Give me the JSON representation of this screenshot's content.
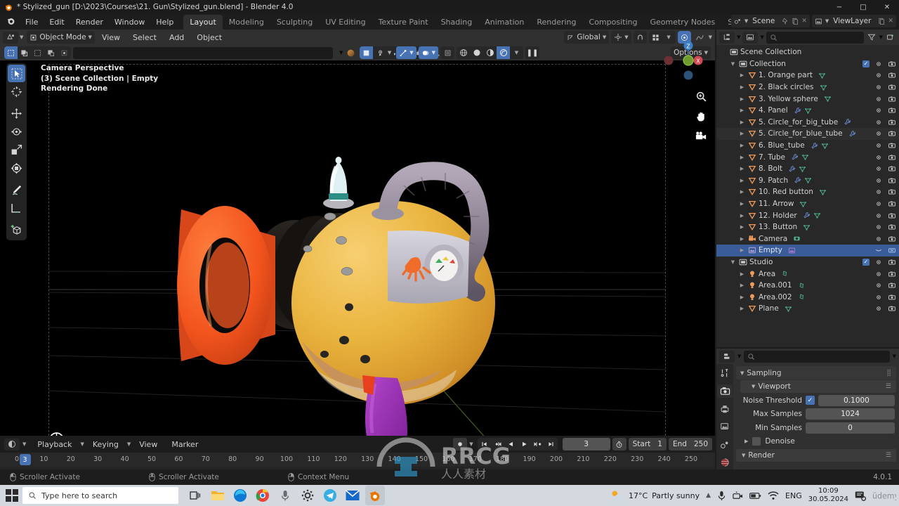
{
  "window": {
    "title": "* Stylized_gun [D:\\2023\\Courses\\21. Gun\\Stylized_gun.blend] - Blender 4.0",
    "minimize": "−",
    "maximize": "□",
    "close": "✕"
  },
  "topbar": {
    "menus": [
      "File",
      "Edit",
      "Render",
      "Window",
      "Help"
    ],
    "workspaces": [
      {
        "label": "Layout",
        "active": true
      },
      {
        "label": "Modeling",
        "active": false
      },
      {
        "label": "Sculpting",
        "active": false
      },
      {
        "label": "UV Editing",
        "active": false
      },
      {
        "label": "Texture Paint",
        "active": false
      },
      {
        "label": "Shading",
        "active": false
      },
      {
        "label": "Animation",
        "active": false
      },
      {
        "label": "Rendering",
        "active": false
      },
      {
        "label": "Compositing",
        "active": false
      },
      {
        "label": "Geometry Nodes",
        "active": false
      },
      {
        "label": "Scripting",
        "active": false
      },
      {
        "label": "+",
        "active": false
      }
    ],
    "scene_name": "Scene",
    "viewlayer_name": "ViewLayer"
  },
  "viewport": {
    "mode": "Object Mode",
    "menus": [
      "View",
      "Select",
      "Add",
      "Object"
    ],
    "transform_orientation": "Global",
    "options_label": "Options",
    "overlay_lines": [
      "Camera Perspective",
      "(3) Scene Collection | Empty",
      "Rendering Done"
    ],
    "gizmo_axes": {
      "x": "X",
      "y": "Y",
      "z": "Z"
    },
    "tools": [
      "tweak-select-tool",
      "cursor-tool",
      "move-tool",
      "rotate-tool",
      "scale-tool",
      "transform-tool",
      "annotate-tool",
      "measure-tool",
      "add-cube-tool"
    ]
  },
  "timeline": {
    "editor_menus": [
      "Playback",
      "Keying",
      "View",
      "Marker"
    ],
    "current_frame": "3",
    "start_label": "Start",
    "start_value": "1",
    "end_label": "End",
    "end_value": "250",
    "ticks": [
      "0",
      "10",
      "20",
      "30",
      "40",
      "50",
      "60",
      "70",
      "80",
      "90",
      "100",
      "110",
      "120",
      "130",
      "140",
      "150",
      "160",
      "170",
      "180",
      "190",
      "200",
      "210",
      "220",
      "230",
      "240",
      "250"
    ]
  },
  "outliner": {
    "search_placeholder": "",
    "rows": [
      {
        "indent": 0,
        "label": "Scene Collection",
        "icon": "collection-icon",
        "arrow": "",
        "mods": [],
        "checkbox": false,
        "eye": false,
        "camera": false,
        "selected": false
      },
      {
        "indent": 1,
        "label": "Collection",
        "icon": "collection-icon",
        "arrow": "▼",
        "mods": [],
        "checkbox": true,
        "eye": true,
        "camera": true,
        "selected": false
      },
      {
        "indent": 2,
        "label": "1. Orange part",
        "icon": "mesh-icon",
        "arrow": "▶",
        "mods": [
          "mesh-data"
        ],
        "checkbox": false,
        "eye": true,
        "camera": true,
        "selected": false
      },
      {
        "indent": 2,
        "label": "2. Black circles",
        "icon": "mesh-icon",
        "arrow": "▶",
        "mods": [
          "mesh-data"
        ],
        "checkbox": false,
        "eye": true,
        "camera": true,
        "selected": false
      },
      {
        "indent": 2,
        "label": "3. Yellow sphere",
        "icon": "mesh-icon",
        "arrow": "▶",
        "mods": [
          "mesh-data"
        ],
        "checkbox": false,
        "eye": true,
        "camera": true,
        "selected": false
      },
      {
        "indent": 2,
        "label": "4. Panel",
        "icon": "mesh-icon",
        "arrow": "▶",
        "mods": [
          "modifier",
          "mesh-data"
        ],
        "checkbox": false,
        "eye": true,
        "camera": true,
        "selected": false
      },
      {
        "indent": 2,
        "label": "5. Circle_for_big_tube",
        "icon": "mesh-icon",
        "arrow": "▶",
        "mods": [
          "modifier"
        ],
        "checkbox": false,
        "eye": true,
        "camera": true,
        "selected": false
      },
      {
        "indent": 2,
        "label": "5. Circle_for_blue_tube",
        "icon": "mesh-icon",
        "arrow": "▶",
        "mods": [
          "modifier"
        ],
        "checkbox": false,
        "eye": true,
        "camera": true,
        "selected": false
      },
      {
        "indent": 2,
        "label": "6. Blue_tube",
        "icon": "mesh-icon",
        "arrow": "▶",
        "mods": [
          "modifier",
          "mesh-data"
        ],
        "checkbox": false,
        "eye": true,
        "camera": true,
        "selected": false
      },
      {
        "indent": 2,
        "label": "7. Tube",
        "icon": "mesh-icon",
        "arrow": "▶",
        "mods": [
          "modifier",
          "mesh-data"
        ],
        "checkbox": false,
        "eye": true,
        "camera": true,
        "selected": false
      },
      {
        "indent": 2,
        "label": "8. Bolt",
        "icon": "mesh-icon",
        "arrow": "▶",
        "mods": [
          "modifier",
          "mesh-data"
        ],
        "checkbox": false,
        "eye": true,
        "camera": true,
        "selected": false
      },
      {
        "indent": 2,
        "label": "9. Patch",
        "icon": "mesh-icon",
        "arrow": "▶",
        "mods": [
          "modifier",
          "mesh-data"
        ],
        "checkbox": false,
        "eye": true,
        "camera": true,
        "selected": false
      },
      {
        "indent": 2,
        "label": "10. Red button",
        "icon": "mesh-icon",
        "arrow": "▶",
        "mods": [
          "mesh-data"
        ],
        "checkbox": false,
        "eye": true,
        "camera": true,
        "selected": false
      },
      {
        "indent": 2,
        "label": "11. Arrow",
        "icon": "mesh-icon",
        "arrow": "▶",
        "mods": [
          "mesh-data"
        ],
        "checkbox": false,
        "eye": true,
        "camera": true,
        "selected": false
      },
      {
        "indent": 2,
        "label": "12. Holder",
        "icon": "mesh-icon",
        "arrow": "▶",
        "mods": [
          "modifier",
          "mesh-data"
        ],
        "checkbox": false,
        "eye": true,
        "camera": true,
        "selected": false
      },
      {
        "indent": 2,
        "label": "13. Button",
        "icon": "mesh-icon",
        "arrow": "▶",
        "mods": [
          "mesh-data"
        ],
        "checkbox": false,
        "eye": true,
        "camera": true,
        "selected": false
      },
      {
        "indent": 2,
        "label": "Camera",
        "icon": "camera-object-icon",
        "arrow": "▶",
        "mods": [
          "camera-data"
        ],
        "checkbox": false,
        "eye": true,
        "camera": true,
        "selected": false
      },
      {
        "indent": 2,
        "label": "Empty",
        "icon": "empty-image-icon",
        "arrow": "▶",
        "mods": [
          "empty-data"
        ],
        "checkbox": false,
        "eye": true,
        "camera": true,
        "selected": true
      },
      {
        "indent": 1,
        "label": "Studio",
        "icon": "collection-icon",
        "arrow": "▼",
        "mods": [],
        "checkbox": true,
        "eye": true,
        "camera": true,
        "selected": false
      },
      {
        "indent": 2,
        "label": "Area",
        "icon": "light-icon",
        "arrow": "▶",
        "mods": [
          "light-data"
        ],
        "checkbox": false,
        "eye": true,
        "camera": true,
        "selected": false
      },
      {
        "indent": 2,
        "label": "Area.001",
        "icon": "light-icon",
        "arrow": "▶",
        "mods": [
          "light-data"
        ],
        "checkbox": false,
        "eye": true,
        "camera": true,
        "selected": false
      },
      {
        "indent": 2,
        "label": "Area.002",
        "icon": "light-icon",
        "arrow": "▶",
        "mods": [
          "light-data"
        ],
        "checkbox": false,
        "eye": true,
        "camera": true,
        "selected": false
      },
      {
        "indent": 2,
        "label": "Plane",
        "icon": "mesh-icon",
        "arrow": "▶",
        "mods": [
          "mesh-data"
        ],
        "checkbox": false,
        "eye": true,
        "camera": true,
        "selected": false
      }
    ]
  },
  "properties": {
    "search_placeholder": "",
    "tabs": [
      "tool-tab",
      "render-tab",
      "output-tab",
      "viewlayer-tab",
      "scene-tab",
      "world-tab"
    ],
    "active_tab": "render-tab",
    "sampling_label": "Sampling",
    "viewport_label": "Viewport",
    "noise_threshold_label": "Noise Threshold",
    "noise_threshold_value": "0.1000",
    "noise_threshold_enabled": true,
    "max_samples_label": "Max Samples",
    "max_samples_value": "1024",
    "min_samples_label": "Min Samples",
    "min_samples_value": "0",
    "denoise_label": "Denoise",
    "render_label": "Render"
  },
  "statusbar": {
    "items": [
      "Scroller Activate",
      "Scroller Activate",
      "Context Menu"
    ],
    "version": "4.0.1"
  },
  "taskbar": {
    "search_placeholder": "Type here to search",
    "weather_temp": "17°C",
    "weather_desc": "Partly sunny",
    "language": "ENG",
    "time": "10:09",
    "date": "30.05.2024"
  },
  "colors": {
    "accent_blue": "#4772b3",
    "orange": "#f15a24",
    "yellow": "#e8b53c",
    "purple": "#9b30b0",
    "mesh_icon": "#ee9a5a",
    "data_icon": "#4fb08a",
    "modifier_icon": "#6f8fd4"
  }
}
